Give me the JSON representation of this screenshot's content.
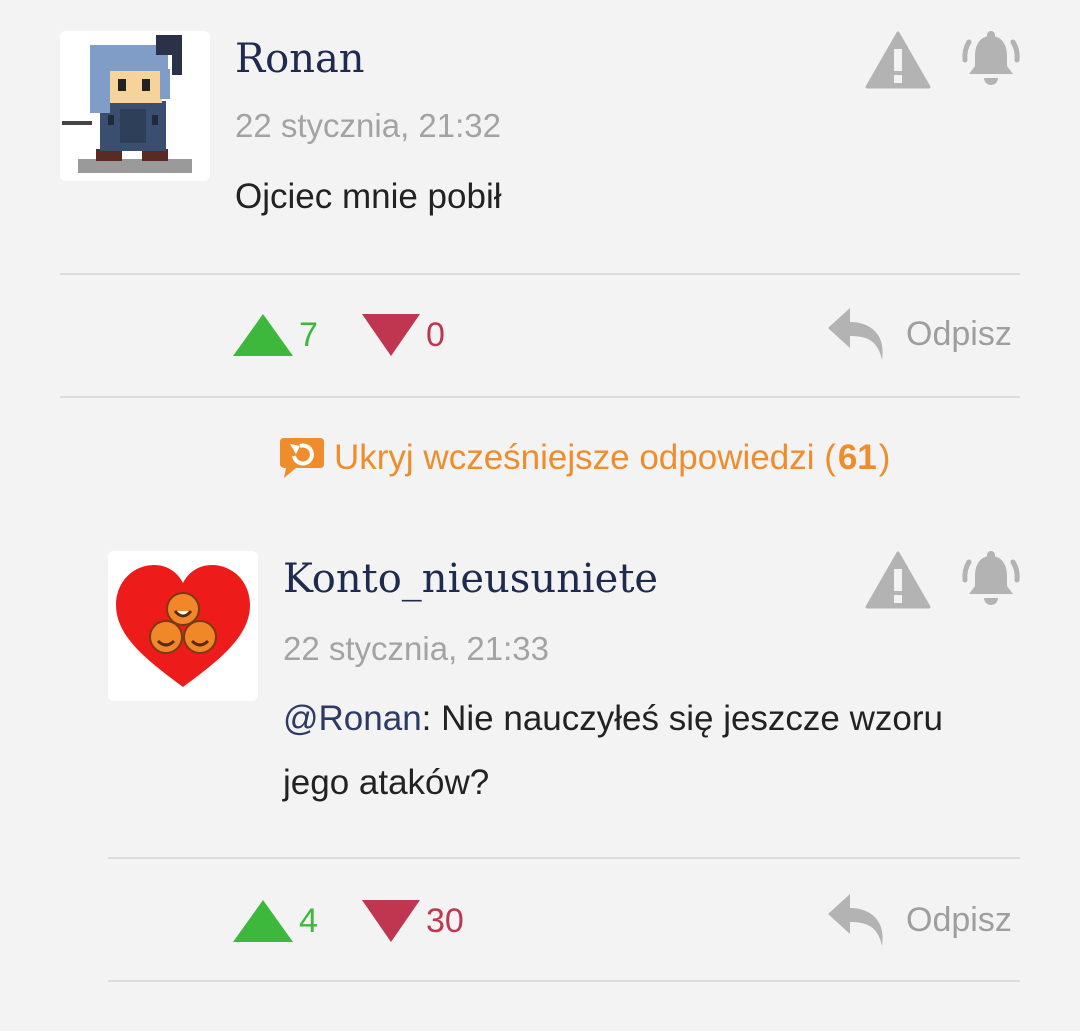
{
  "comments": [
    {
      "author": "Ronan",
      "timestamp": "22 stycznia, 21:32",
      "text": "Ojciec mnie pobił",
      "upvotes": "7",
      "downvotes": "0",
      "reply_label": "Odpisz"
    },
    {
      "author": "Konto_nieusuniete",
      "timestamp": "22 stycznia, 21:33",
      "mention": "@Ronan",
      "text": ": Nie nauczyłeś się jeszcze wzoru jego ataków?",
      "upvotes": "4",
      "downvotes": "30",
      "reply_label": "Odpisz"
    }
  ],
  "hide_earlier": {
    "label": "Ukryj wcześniejsze odpowiedzi (",
    "count": "61",
    "close": ")"
  },
  "colors": {
    "upvote": "#3db83d",
    "downvote": "#c0354f",
    "accent": "#ef8d2c",
    "username": "#1f2a4f"
  },
  "icons": [
    "warning-icon",
    "bell-icon",
    "upvote-icon",
    "downvote-icon",
    "reply-icon",
    "hide-replies-icon"
  ]
}
